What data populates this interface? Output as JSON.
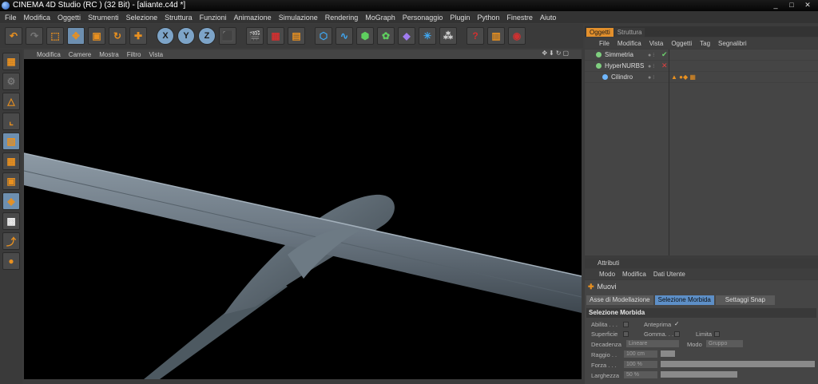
{
  "title_bar": {
    "title": "CINEMA 4D Studio (RC ) (32 Bit) - [aliante.c4d *]",
    "controls": [
      "_",
      "□",
      "✕"
    ]
  },
  "menu": [
    "File",
    "Modifica",
    "Oggetti",
    "Strumenti",
    "Selezione",
    "Struttura",
    "Funzioni",
    "Animazione",
    "Simulazione",
    "Rendering",
    "MoGraph",
    "Personaggio",
    "Plugin",
    "Python",
    "Finestre",
    "Aiuto"
  ],
  "toolbar": {
    "undo": "↶",
    "redo": "↷",
    "select": "⬚",
    "move": "✥",
    "scale": "▣",
    "rotate": "↻",
    "add": "✚",
    "x_axis": "X",
    "y_axis": "Y",
    "z_axis": "Z",
    "coord": "⬛",
    "render_view": "🎬",
    "render_region": "▦",
    "render_settings": "▤",
    "cube": "⬡",
    "spline": "∿",
    "nurbs": "⬢",
    "array": "✿",
    "deformer": "◆",
    "scene": "✳",
    "light": "⁂",
    "help": "?",
    "layout": "▥",
    "web": "◉"
  },
  "left_toolbar": [
    "▦",
    "⚙",
    "△",
    "⌞",
    "▧",
    "▦",
    "▣",
    "◈",
    "▩",
    "⤴",
    "●"
  ],
  "viewport": {
    "menu": [
      "Modifica",
      "Camere",
      "Mostra",
      "Filtro",
      "Vista"
    ],
    "nav_icons": "✥⬇↻▢"
  },
  "object_manager": {
    "tabs": [
      "Oggetti",
      "Struttura"
    ],
    "menu": [
      "File",
      "Modifica",
      "Vista",
      "Oggetti",
      "Tag",
      "Segnalibri"
    ],
    "objects": [
      {
        "name": "Simmetria",
        "status": "✔",
        "status_color": "#6cd06c",
        "icon_color": "#7fcf7f"
      },
      {
        "name": "HyperNURBS",
        "status": "✕",
        "status_color": "#e04040",
        "icon_color": "#7fcf7f"
      },
      {
        "name": "Cilindro",
        "status": "",
        "status_color": "#888888",
        "icon_color": "#6fb7ff",
        "tags": "▲ ●◆ ▦"
      }
    ]
  },
  "attributes": {
    "title": "Attributi",
    "menu": [
      "Modo",
      "Modifica",
      "Dati Utente"
    ],
    "tool_name": "Muovi",
    "tabs": [
      "Asse di Modellazione",
      "Selezione Morbida",
      "Settaggi Snap"
    ],
    "section": "Selezione Morbida",
    "props": {
      "abilita": "Abilita . . .",
      "anteprima": "Anteprima",
      "anteprima_check": "✓",
      "superficie": "Superficie",
      "gomma": "Gomma. . .",
      "limita": "Limita",
      "decadenza": "Decadenza",
      "decadenza_val": "Lineare",
      "modo": "Modo",
      "modo_val": "Gruppo",
      "raggio": "Raggio . .",
      "raggio_val": "100 cm",
      "forza": "Forza . . .",
      "forza_val": "100 %",
      "larghezza": "Larghezza",
      "larghezza_val": "50 %"
    }
  }
}
